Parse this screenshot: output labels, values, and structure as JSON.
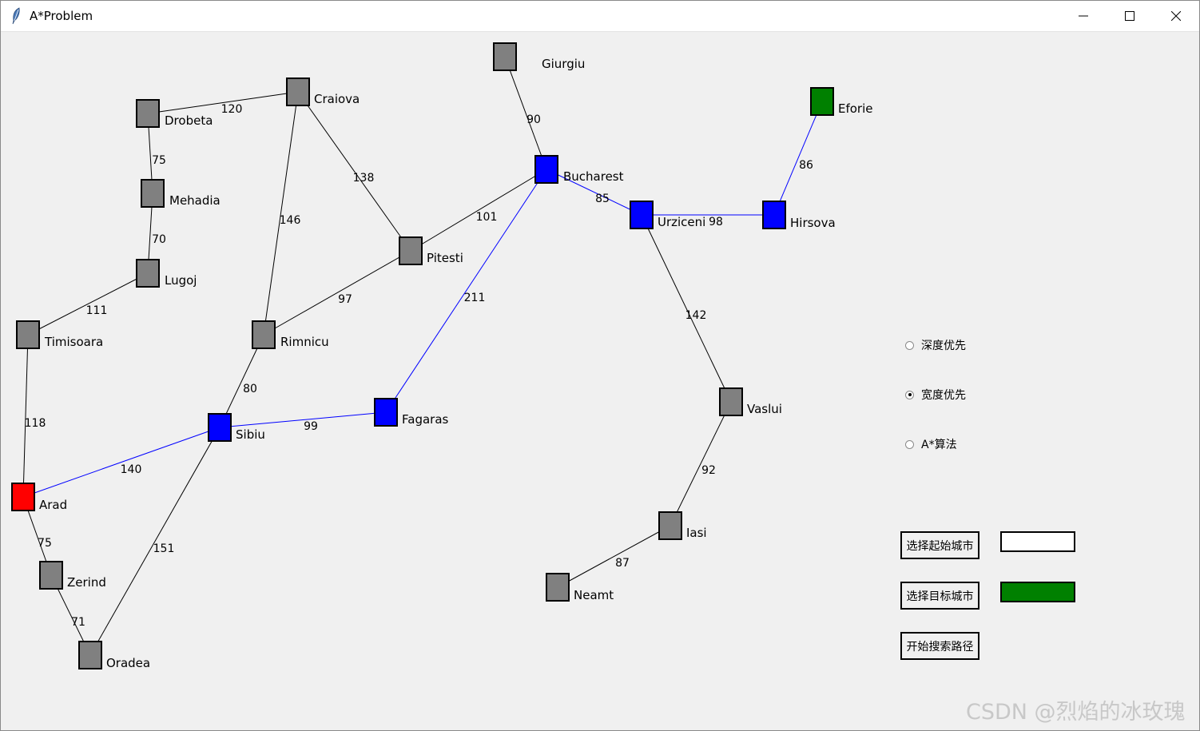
{
  "window": {
    "title": "A*Problem"
  },
  "colors": {
    "gray": "#808080",
    "blue": "#0000ff",
    "red": "#ff0000",
    "green": "#008000",
    "path": "#0000ff",
    "edge": "#000000"
  },
  "cities": [
    {
      "id": "Giurgiu",
      "label": "Giurgiu",
      "state": "gray"
    },
    {
      "id": "Craiova",
      "label": "Craiova",
      "state": "gray"
    },
    {
      "id": "Drobeta",
      "label": "Drobeta",
      "state": "gray"
    },
    {
      "id": "Eforie",
      "label": "Eforie",
      "state": "green"
    },
    {
      "id": "Bucharest",
      "label": "Bucharest",
      "state": "blue"
    },
    {
      "id": "Mehadia",
      "label": "Mehadia",
      "state": "gray"
    },
    {
      "id": "Urziceni",
      "label": "Urziceni",
      "state": "blue"
    },
    {
      "id": "Hirsova",
      "label": "Hirsova",
      "state": "blue"
    },
    {
      "id": "Pitesti",
      "label": "Pitesti",
      "state": "gray"
    },
    {
      "id": "Lugoj",
      "label": "Lugoj",
      "state": "gray"
    },
    {
      "id": "Timisoara",
      "label": "Timisoara",
      "state": "gray"
    },
    {
      "id": "Rimnicu",
      "label": "Rimnicu",
      "state": "gray"
    },
    {
      "id": "Vaslui",
      "label": "Vaslui",
      "state": "gray"
    },
    {
      "id": "Fagaras",
      "label": "Fagaras",
      "state": "blue"
    },
    {
      "id": "Sibiu",
      "label": "Sibiu",
      "state": "blue"
    },
    {
      "id": "Arad",
      "label": "Arad",
      "state": "red"
    },
    {
      "id": "Iasi",
      "label": "Iasi",
      "state": "gray"
    },
    {
      "id": "Zerind",
      "label": "Zerind",
      "state": "gray"
    },
    {
      "id": "Neamt",
      "label": "Neamt",
      "state": "gray"
    },
    {
      "id": "Oradea",
      "label": "Oradea",
      "state": "gray"
    }
  ],
  "edges": [
    {
      "a": "Drobeta",
      "b": "Craiova",
      "w": "120",
      "path": false
    },
    {
      "a": "Drobeta",
      "b": "Mehadia",
      "w": "75",
      "path": false
    },
    {
      "a": "Mehadia",
      "b": "Lugoj",
      "w": "70",
      "path": false
    },
    {
      "a": "Lugoj",
      "b": "Timisoara",
      "w": "111",
      "path": false
    },
    {
      "a": "Timisoara",
      "b": "Arad",
      "w": "118",
      "path": false
    },
    {
      "a": "Craiova",
      "b": "Rimnicu",
      "w": "146",
      "path": false
    },
    {
      "a": "Craiova",
      "b": "Pitesti",
      "w": "138",
      "path": false
    },
    {
      "a": "Pitesti",
      "b": "Bucharest",
      "w": "101",
      "path": false
    },
    {
      "a": "Pitesti",
      "b": "Rimnicu",
      "w": "97",
      "path": false
    },
    {
      "a": "Rimnicu",
      "b": "Sibiu",
      "w": "80",
      "path": false
    },
    {
      "a": "Giurgiu",
      "b": "Bucharest",
      "w": "90",
      "path": false
    },
    {
      "a": "Bucharest",
      "b": "Fagaras",
      "w": "211",
      "path": true
    },
    {
      "a": "Bucharest",
      "b": "Urziceni",
      "w": "85",
      "path": true
    },
    {
      "a": "Urziceni",
      "b": "Hirsova",
      "w": "98",
      "path": true
    },
    {
      "a": "Hirsova",
      "b": "Eforie",
      "w": "86",
      "path": true
    },
    {
      "a": "Urziceni",
      "b": "Vaslui",
      "w": "142",
      "path": false
    },
    {
      "a": "Vaslui",
      "b": "Iasi",
      "w": "92",
      "path": false
    },
    {
      "a": "Iasi",
      "b": "Neamt",
      "w": "87",
      "path": false
    },
    {
      "a": "Sibiu",
      "b": "Fagaras",
      "w": "99",
      "path": true
    },
    {
      "a": "Arad",
      "b": "Sibiu",
      "w": "140",
      "path": true
    },
    {
      "a": "Arad",
      "b": "Zerind",
      "w": "75",
      "path": false
    },
    {
      "a": "Zerind",
      "b": "Oradea",
      "w": "71",
      "path": false
    },
    {
      "a": "Sibiu",
      "b": "Oradea",
      "w": "151",
      "path": false
    }
  ],
  "controls": {
    "radios": [
      {
        "label": "深度优先",
        "checked": false
      },
      {
        "label": "宽度优先",
        "checked": true
      },
      {
        "label": "A*算法",
        "checked": false
      }
    ],
    "select_start_label": "选择起始城市",
    "select_goal_label": "选择目标城市",
    "start_search_label": "开始搜索路径",
    "start_swatch": "#ffffff",
    "goal_swatch": "#008000"
  },
  "watermark": "CSDN @烈焰的冰玫瑰"
}
